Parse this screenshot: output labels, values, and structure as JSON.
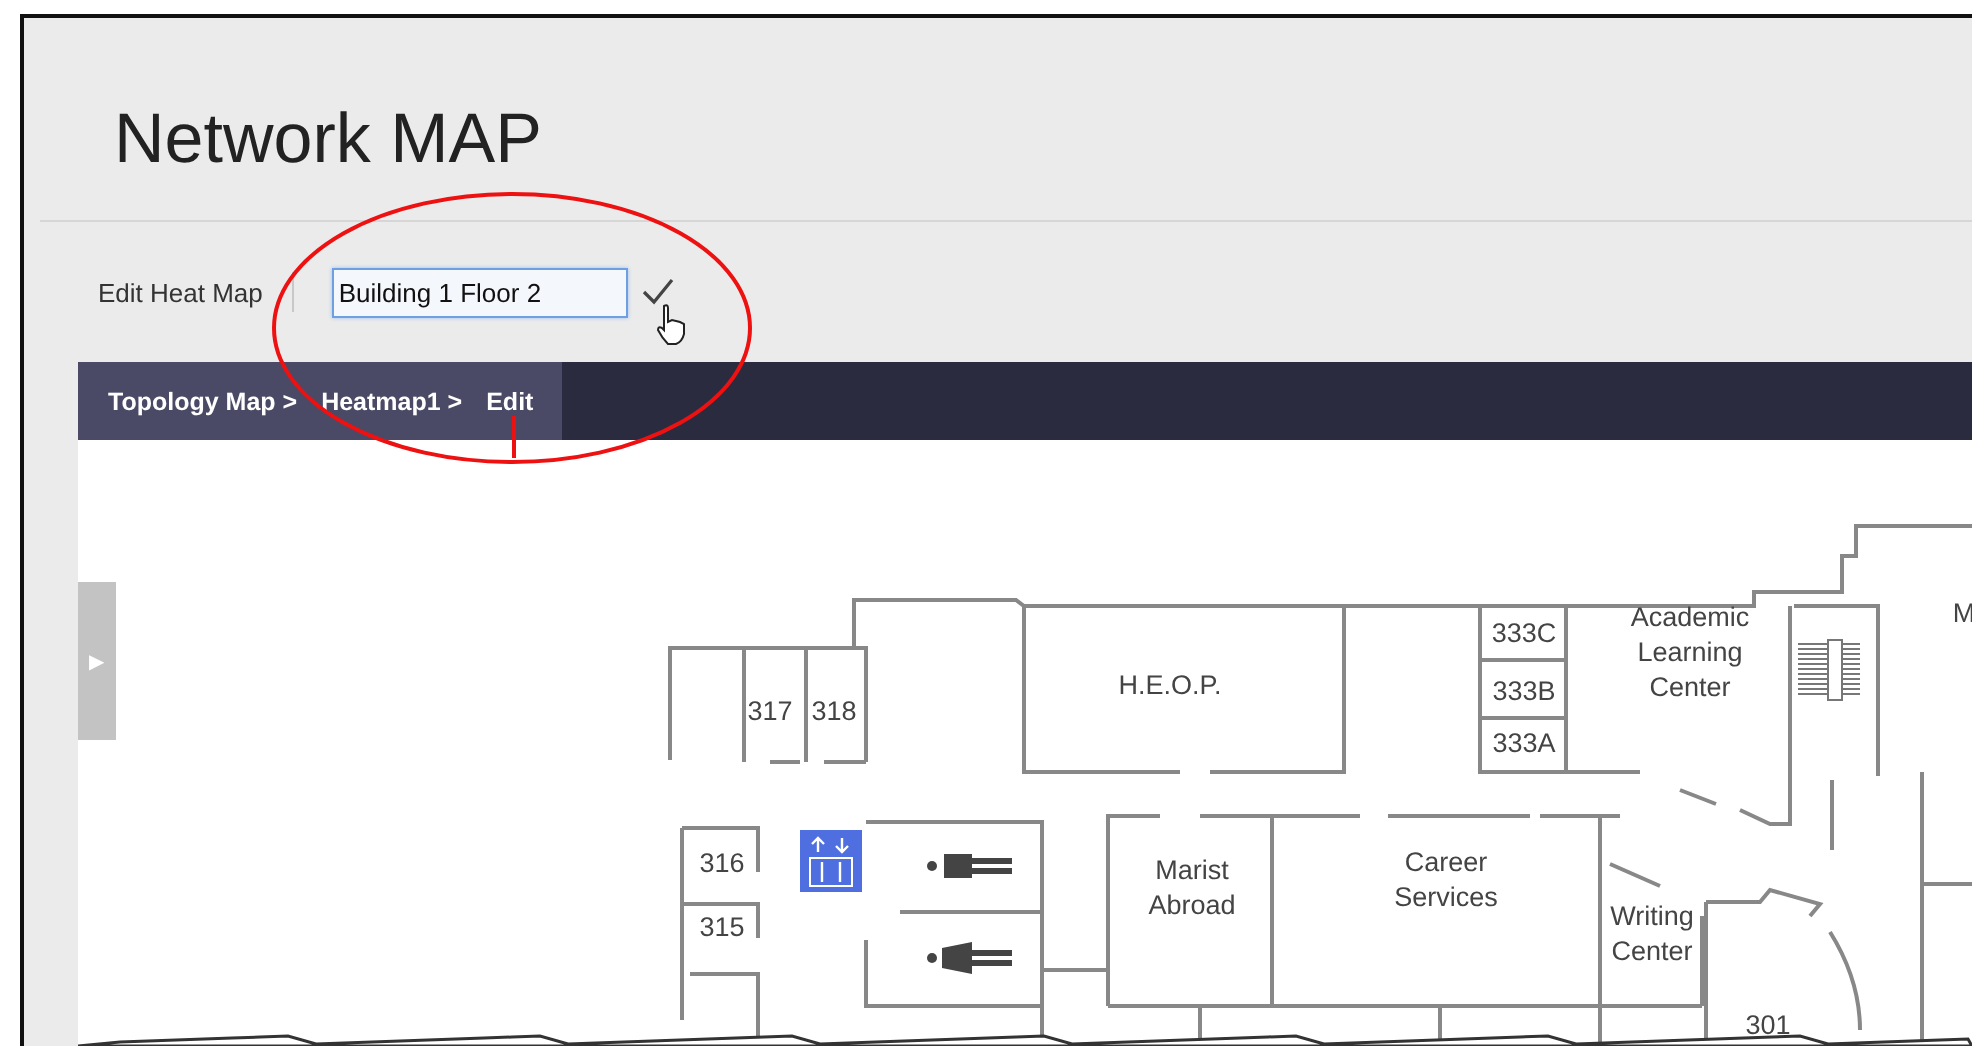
{
  "page": {
    "title": "Network MAP"
  },
  "edit_bar": {
    "label": "Edit Heat Map",
    "name_field": {
      "value": "Building 1 Floor 2",
      "focused": true
    }
  },
  "breadcrumb": [
    {
      "label": "Topology Map >"
    },
    {
      "label": "Heatmap1 >"
    },
    {
      "label": "Edit"
    }
  ],
  "side_toggle": {
    "label": "▶"
  },
  "floor_plan": {
    "rooms": [
      {
        "label": "317"
      },
      {
        "label": "318"
      },
      {
        "label": "316"
      },
      {
        "label": "315"
      },
      {
        "label": "H.E.O.P."
      },
      {
        "label": "333C"
      },
      {
        "label": "333B"
      },
      {
        "label": "333A"
      },
      {
        "label": "Academic Learning Center"
      },
      {
        "label": "Marist Abroad"
      },
      {
        "label": "Career Services"
      },
      {
        "label": "Writing Center"
      },
      {
        "label": "301"
      },
      {
        "label": "M"
      }
    ]
  }
}
